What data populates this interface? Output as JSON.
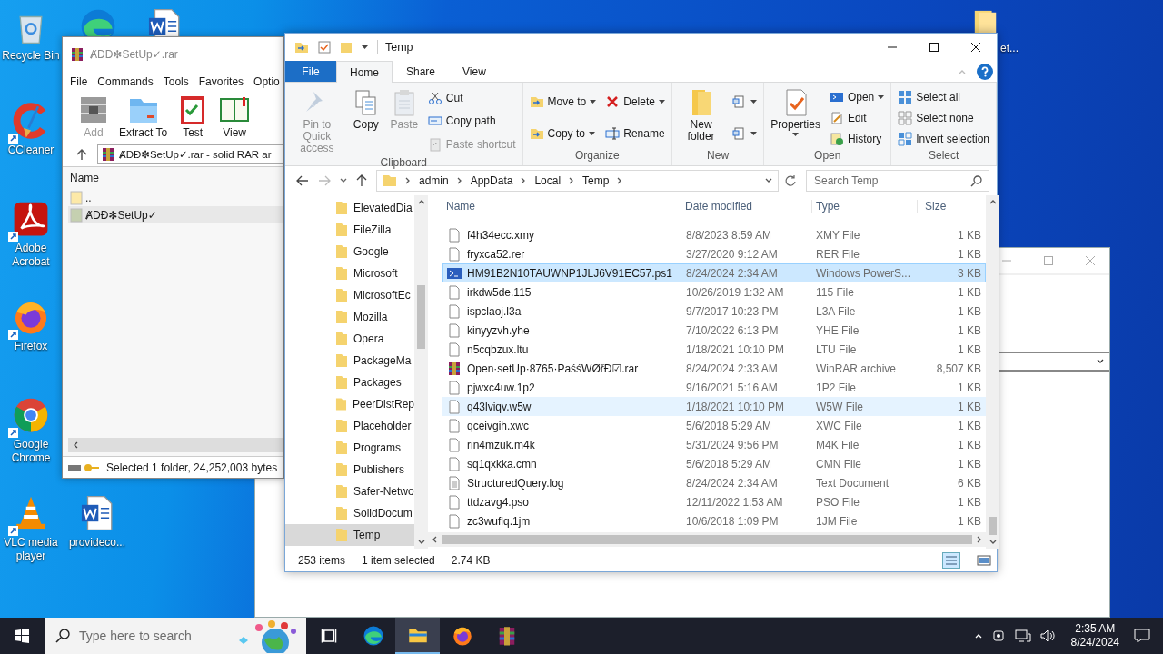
{
  "desktop_icons": [
    {
      "kind": "recycle",
      "label": "Recycle Bin",
      "shortcut": false
    },
    {
      "kind": "edge",
      "shortcut": false
    },
    {
      "kind": "word",
      "shortcut": false
    },
    {
      "kind": "ccleaner",
      "label": "CCleaner",
      "shortcut": true
    },
    {
      "kind": "acrobat",
      "label": "Adobe Acrobat",
      "shortcut": true
    },
    {
      "kind": "firefox",
      "label": "Firefox",
      "shortcut": true
    },
    {
      "kind": "chrome",
      "label": "Google Chrome",
      "shortcut": true
    },
    {
      "kind": "vlc",
      "label": "VLC media player",
      "shortcut": true
    },
    {
      "kind": "word",
      "label": "provideco...",
      "shortcut": false
    },
    {
      "kind": "folder",
      "label": "et...",
      "shortcut": false
    }
  ],
  "winrar": {
    "title": "ȺDĐ✻SetUp✓.rar",
    "menu": [
      "File",
      "Commands",
      "Tools",
      "Favorites",
      "Optio"
    ],
    "tools": [
      {
        "kind": "add",
        "label": "Add",
        "disabled": true
      },
      {
        "kind": "extract",
        "label": "Extract To",
        "disabled": false
      },
      {
        "kind": "test",
        "label": "Test",
        "disabled": false
      },
      {
        "kind": "view",
        "label": "View",
        "disabled": false
      }
    ],
    "path": "ȺDĐ✻SetUp✓.rar - solid RAR ar",
    "column": "Name",
    "items": [
      {
        "kind": "up",
        "name": "..",
        "selected": false
      },
      {
        "kind": "folder",
        "name": "ȺDĐ✻SetUp✓",
        "selected": true
      }
    ],
    "status": "Selected 1 folder, 24,252,003 bytes"
  },
  "explorer": {
    "title": "Temp",
    "tabs": [
      {
        "kind": "file",
        "label": "File",
        "selected": false
      },
      {
        "kind": "tab",
        "label": "Home",
        "selected": true
      },
      {
        "kind": "tab",
        "label": "Share",
        "selected": false
      },
      {
        "kind": "tab",
        "label": "View",
        "selected": false
      }
    ],
    "ribbon": [
      {
        "name": "Clipboard",
        "items": [
          {
            "kind": "big",
            "label": "Pin to Quick access",
            "disabled": true,
            "dropdown": false
          },
          {
            "kind": "big",
            "label": "Copy",
            "disabled": false,
            "dropdown": false
          },
          {
            "kind": "big",
            "label": "Paste",
            "disabled": true,
            "dropdown": false
          },
          {
            "kind": "stack",
            "items": [
              {
                "label": "Cut",
                "disabled": false,
                "dropdown": false
              },
              {
                "label": "Copy path",
                "disabled": false,
                "dropdown": false
              },
              {
                "label": "Paste shortcut",
                "disabled": true,
                "dropdown": false
              }
            ]
          }
        ]
      },
      {
        "name": "Organize",
        "items": [
          {
            "kind": "stack",
            "items": [
              {
                "label": "Move to",
                "disabled": false,
                "dropdown": true
              },
              {
                "label": "Copy to",
                "disabled": false,
                "dropdown": true
              }
            ]
          },
          {
            "kind": "stack",
            "items": [
              {
                "label": "Delete",
                "disabled": false,
                "dropdown": true
              },
              {
                "label": "Rename",
                "disabled": false,
                "dropdown": false
              }
            ]
          }
        ]
      },
      {
        "name": "New",
        "items": [
          {
            "kind": "big",
            "label": "New folder",
            "disabled": false,
            "dropdown": false
          },
          {
            "kind": "stack",
            "items": [
              {
                "disabled": false,
                "dropdown": true
              },
              {
                "disabled": false,
                "dropdown": true
              }
            ]
          }
        ]
      },
      {
        "name": "Open",
        "items": [
          {
            "kind": "big",
            "label": "Properties",
            "disabled": false,
            "dropdown": true
          },
          {
            "kind": "stack",
            "items": [
              {
                "label": "Open",
                "disabled": false,
                "dropdown": true
              },
              {
                "label": "Edit",
                "disabled": false,
                "dropdown": false
              },
              {
                "label": "History",
                "disabled": false,
                "dropdown": false
              }
            ]
          }
        ]
      },
      {
        "name": "Select",
        "items": [
          {
            "kind": "stack",
            "items": [
              {
                "label": "Select all",
                "disabled": false,
                "dropdown": false
              },
              {
                "label": "Select none",
                "disabled": false,
                "dropdown": false
              },
              {
                "label": "Invert selection",
                "disabled": false,
                "dropdown": false
              }
            ]
          }
        ]
      }
    ],
    "crumbs": [
      "admin",
      "AppData",
      "Local",
      "Temp"
    ],
    "search": {
      "placeholder": "Search Temp"
    },
    "nav": [
      {
        "name": "ElevatedDia",
        "selected": false
      },
      {
        "name": "FileZilla",
        "selected": false
      },
      {
        "name": "Google",
        "selected": false
      },
      {
        "name": "Microsoft",
        "selected": false
      },
      {
        "name": "MicrosoftEc",
        "selected": false
      },
      {
        "name": "Mozilla",
        "selected": false
      },
      {
        "name": "Opera",
        "selected": false
      },
      {
        "name": "PackageMa",
        "selected": false
      },
      {
        "name": "Packages",
        "selected": false
      },
      {
        "name": "PeerDistRep",
        "selected": false
      },
      {
        "name": "Placeholder",
        "selected": false
      },
      {
        "name": "Programs",
        "selected": false
      },
      {
        "name": "Publishers",
        "selected": false
      },
      {
        "name": "Safer-Netwo",
        "selected": false
      },
      {
        "name": "SolidDocum",
        "selected": false
      },
      {
        "name": "Temp",
        "selected": true
      }
    ],
    "columns": [
      "Name",
      "Date modified",
      "Type",
      "Size"
    ],
    "files": [
      {
        "kind": "file",
        "name": "f4h34ecc.xmy",
        "date": "8/8/2023 8:59 AM",
        "type": "XMY File",
        "size": "1 KB",
        "selected": false,
        "hovered": false
      },
      {
        "kind": "file",
        "name": "fryxca52.rer",
        "date": "3/27/2020 9:12 AM",
        "type": "RER File",
        "size": "1 KB",
        "selected": false,
        "hovered": false
      },
      {
        "kind": "powershell",
        "name": "HM91B2N10TAUWNP1JLJ6V91EC57.ps1",
        "date": "8/24/2024 2:34 AM",
        "type": "Windows PowerS...",
        "size": "3 KB",
        "selected": true,
        "hovered": false
      },
      {
        "kind": "file",
        "name": "irkdw5de.115",
        "date": "10/26/2019 1:32 AM",
        "type": "115 File",
        "size": "1 KB",
        "selected": false,
        "hovered": false
      },
      {
        "kind": "file",
        "name": "ispclaoj.l3a",
        "date": "9/7/2017 10:23 PM",
        "type": "L3A File",
        "size": "1 KB",
        "selected": false,
        "hovered": false
      },
      {
        "kind": "file",
        "name": "kinyyzvh.yhe",
        "date": "7/10/2022 6:13 PM",
        "type": "YHE File",
        "size": "1 KB",
        "selected": false,
        "hovered": false
      },
      {
        "kind": "file",
        "name": "n5cqbzux.ltu",
        "date": "1/18/2021 10:10 PM",
        "type": "LTU File",
        "size": "1 KB",
        "selected": false,
        "hovered": false
      },
      {
        "kind": "winrar",
        "name": "Open·setUp·8765·PaśśWØřĐ☑.rar",
        "date": "8/24/2024 2:33 AM",
        "type": "WinRAR archive",
        "size": "8,507 KB",
        "selected": false,
        "hovered": false
      },
      {
        "kind": "file",
        "name": "pjwxc4uw.1p2",
        "date": "9/16/2021 5:16 AM",
        "type": "1P2 File",
        "size": "1 KB",
        "selected": false,
        "hovered": false
      },
      {
        "kind": "file",
        "name": "q43lviqv.w5w",
        "date": "1/18/2021 10:10 PM",
        "type": "W5W File",
        "size": "1 KB",
        "selected": false,
        "hovered": true
      },
      {
        "kind": "file",
        "name": "qceivgih.xwc",
        "date": "5/6/2018 5:29 AM",
        "type": "XWC File",
        "size": "1 KB",
        "selected": false,
        "hovered": false
      },
      {
        "kind": "file",
        "name": "rin4mzuk.m4k",
        "date": "5/31/2024 9:56 PM",
        "type": "M4K File",
        "size": "1 KB",
        "selected": false,
        "hovered": false
      },
      {
        "kind": "file",
        "name": "sq1qxkka.cmn",
        "date": "5/6/2018 5:29 AM",
        "type": "CMN File",
        "size": "1 KB",
        "selected": false,
        "hovered": false
      },
      {
        "kind": "text",
        "name": "StructuredQuery.log",
        "date": "8/24/2024 2:34 AM",
        "type": "Text Document",
        "size": "6 KB",
        "selected": false,
        "hovered": false
      },
      {
        "kind": "file",
        "name": "ttdzavg4.pso",
        "date": "12/11/2022 1:53 AM",
        "type": "PSO File",
        "size": "1 KB",
        "selected": false,
        "hovered": false
      },
      {
        "kind": "file",
        "name": "zc3wuflq.1jm",
        "date": "10/6/2018 1:09 PM",
        "type": "1JM File",
        "size": "1 KB",
        "selected": false,
        "hovered": false
      }
    ],
    "status": {
      "count": "253 items",
      "selection": "1 item selected",
      "size": "2.74 KB"
    }
  },
  "taskbar": {
    "search_placeholder": "Type here to search",
    "apps": [
      {
        "kind": "taskview",
        "active": false
      },
      {
        "kind": "edge",
        "active": false
      },
      {
        "kind": "explorer",
        "active": true
      },
      {
        "kind": "firefox",
        "active": false
      },
      {
        "kind": "winrar",
        "active": false
      }
    ],
    "time": "2:35 AM",
    "date": "8/24/2024"
  }
}
